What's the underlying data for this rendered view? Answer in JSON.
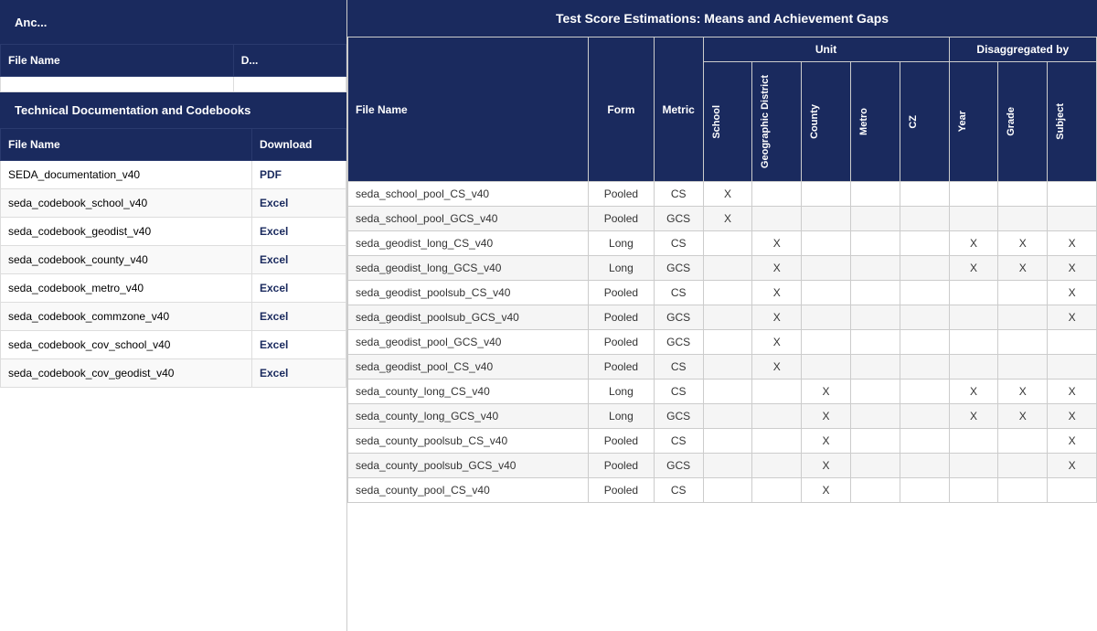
{
  "left": {
    "anchor_header": "Anc...",
    "file_table_header": {
      "filename": "File Name",
      "download": "D..."
    },
    "codebooks_header": "Technical Documentation and Codebooks",
    "codebooks_table_header": {
      "filename": "File Name",
      "download": "Download"
    },
    "codebooks_rows": [
      {
        "name": "SEDA_documentation_v40",
        "download": "PDF"
      },
      {
        "name": "seda_codebook_school_v40",
        "download": "Excel"
      },
      {
        "name": "seda_codebook_geodist_v40",
        "download": "Excel"
      },
      {
        "name": "seda_codebook_county_v40",
        "download": "Excel"
      },
      {
        "name": "seda_codebook_metro_v40",
        "download": "Excel"
      },
      {
        "name": "seda_codebook_commzone_v40",
        "download": "Excel"
      },
      {
        "name": "seda_codebook_cov_school_v40",
        "download": "Excel"
      },
      {
        "name": "seda_codebook_cov_geodist_v40",
        "download": "Excel"
      }
    ]
  },
  "right": {
    "main_title": "Test Score Estimations: Means and Achievement Gaps",
    "header_row1": {
      "filename": "File Name",
      "form": "Form",
      "metric": "Metric",
      "unit": "Unit",
      "disaggregated": "Disaggregated by"
    },
    "header_row2": {
      "school": "School",
      "geo_district": "Geographic District",
      "county": "County",
      "metro": "Metro",
      "cz": "CZ",
      "year": "Year",
      "grade": "Grade",
      "subject": "Subject"
    },
    "rows": [
      {
        "name": "seda_school_pool_CS_v40",
        "form": "Pooled",
        "metric": "CS",
        "school": "X",
        "geo": "",
        "county": "",
        "metro": "",
        "cz": "",
        "year": "",
        "grade": "",
        "subject": ""
      },
      {
        "name": "seda_school_pool_GCS_v40",
        "form": "Pooled",
        "metric": "GCS",
        "school": "X",
        "geo": "",
        "county": "",
        "metro": "",
        "cz": "",
        "year": "",
        "grade": "",
        "subject": ""
      },
      {
        "name": "seda_geodist_long_CS_v40",
        "form": "Long",
        "metric": "CS",
        "school": "",
        "geo": "X",
        "county": "",
        "metro": "",
        "cz": "",
        "year": "X",
        "grade": "X",
        "subject": "X"
      },
      {
        "name": "seda_geodist_long_GCS_v40",
        "form": "Long",
        "metric": "GCS",
        "school": "",
        "geo": "X",
        "county": "",
        "metro": "",
        "cz": "",
        "year": "X",
        "grade": "X",
        "subject": "X"
      },
      {
        "name": "seda_geodist_poolsub_CS_v40",
        "form": "Pooled",
        "metric": "CS",
        "school": "",
        "geo": "X",
        "county": "",
        "metro": "",
        "cz": "",
        "year": "",
        "grade": "",
        "subject": "X"
      },
      {
        "name": "seda_geodist_poolsub_GCS_v40",
        "form": "Pooled",
        "metric": "GCS",
        "school": "",
        "geo": "X",
        "county": "",
        "metro": "",
        "cz": "",
        "year": "",
        "grade": "",
        "subject": "X"
      },
      {
        "name": "seda_geodist_pool_GCS_v40",
        "form": "Pooled",
        "metric": "GCS",
        "school": "",
        "geo": "X",
        "county": "",
        "metro": "",
        "cz": "",
        "year": "",
        "grade": "",
        "subject": ""
      },
      {
        "name": "seda_geodist_pool_CS_v40",
        "form": "Pooled",
        "metric": "CS",
        "school": "",
        "geo": "X",
        "county": "",
        "metro": "",
        "cz": "",
        "year": "",
        "grade": "",
        "subject": ""
      },
      {
        "name": "seda_county_long_CS_v40",
        "form": "Long",
        "metric": "CS",
        "school": "",
        "geo": "",
        "county": "X",
        "metro": "",
        "cz": "",
        "year": "X",
        "grade": "X",
        "subject": "X"
      },
      {
        "name": "seda_county_long_GCS_v40",
        "form": "Long",
        "metric": "GCS",
        "school": "",
        "geo": "",
        "county": "X",
        "metro": "",
        "cz": "",
        "year": "X",
        "grade": "X",
        "subject": "X"
      },
      {
        "name": "seda_county_poolsub_CS_v40",
        "form": "Pooled",
        "metric": "CS",
        "school": "",
        "geo": "",
        "county": "X",
        "metro": "",
        "cz": "",
        "year": "",
        "grade": "",
        "subject": "X"
      },
      {
        "name": "seda_county_poolsub_GCS_v40",
        "form": "Pooled",
        "metric": "GCS",
        "school": "",
        "geo": "",
        "county": "X",
        "metro": "",
        "cz": "",
        "year": "",
        "grade": "",
        "subject": "X"
      },
      {
        "name": "seda_county_pool_CS_v40",
        "form": "Pooled",
        "metric": "CS",
        "school": "",
        "geo": "",
        "county": "X",
        "metro": "",
        "cz": "",
        "year": "",
        "grade": "",
        "subject": ""
      }
    ]
  }
}
